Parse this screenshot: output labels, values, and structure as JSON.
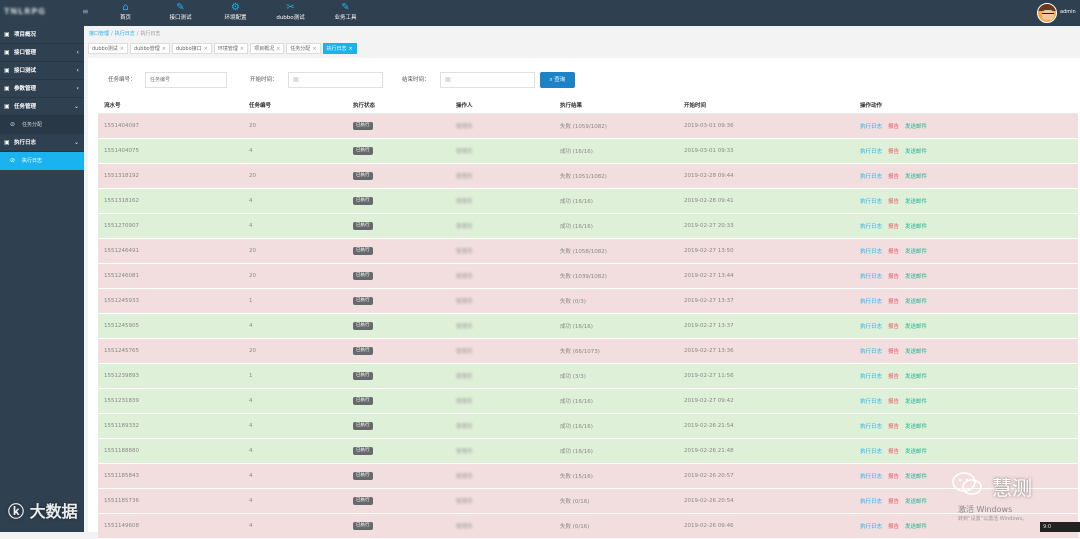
{
  "app": {
    "logo": "TNLRPG",
    "username": "admin"
  },
  "topnav": [
    {
      "label": "首页",
      "icon": "home-icon",
      "glyph": "⌂"
    },
    {
      "label": "接口测试",
      "icon": "edit-icon",
      "glyph": "✎"
    },
    {
      "label": "环境配置",
      "icon": "gear-icon",
      "glyph": "⚙"
    },
    {
      "label": "dubbo测试",
      "icon": "tools-icon",
      "glyph": "✂"
    },
    {
      "label": "业务工具",
      "icon": "wrench-icon",
      "glyph": "✎"
    }
  ],
  "sidebar": {
    "items": [
      {
        "label": "项目概况",
        "icon": "grid-icon",
        "arrow": ""
      },
      {
        "label": "接口管理",
        "icon": "grid-icon",
        "arrow": "‹"
      },
      {
        "label": "接口测试",
        "icon": "grid-icon",
        "arrow": "‹"
      },
      {
        "label": "参数管理",
        "icon": "grid-icon",
        "arrow": "‹"
      },
      {
        "label": "任务管理",
        "icon": "grid-icon",
        "arrow": "⌄"
      },
      {
        "label": "任务分配",
        "icon": "circle-check-icon",
        "arrow": "",
        "sub": true
      },
      {
        "label": "执行日志",
        "icon": "grid-icon",
        "arrow": "⌄"
      },
      {
        "label": "执行日志",
        "icon": "circle-check-icon",
        "arrow": "",
        "sub": true,
        "active": true
      }
    ]
  },
  "breadcrumb": {
    "items": [
      "接口管理",
      "执行日志",
      "执行日志"
    ],
    "separator": "/"
  },
  "tabs": [
    {
      "label": "dubbo测试",
      "active": false
    },
    {
      "label": "dubbo管理",
      "active": false
    },
    {
      "label": "dubbo接口",
      "active": false
    },
    {
      "label": "环境管理",
      "active": false
    },
    {
      "label": "项目概况",
      "active": false
    },
    {
      "label": "任务分配",
      "active": false
    },
    {
      "label": "执行日志",
      "active": true
    }
  ],
  "tab_close": "×",
  "filter": {
    "task_no_label": "任务编号：",
    "task_no_placeholder": "任务编号",
    "start_label": "开始时间：",
    "end_label": "结束时间：",
    "search_label": "查询",
    "search_icon": "search-icon"
  },
  "table": {
    "headers": [
      "流水号",
      "任务编号",
      "执行状态",
      "操作人",
      "执行结果",
      "开始时间",
      "操作动作"
    ],
    "actions": {
      "log": "执行日志",
      "report": "报告",
      "mail": "发送邮件"
    },
    "rows": [
      {
        "serial": "1551404097",
        "task": "20",
        "status": "已执行",
        "operator": "管理员",
        "result": "失败 (1059/1082)",
        "start": "2019-03-01 09:36",
        "state": "fail"
      },
      {
        "serial": "1551404075",
        "task": "4",
        "status": "已执行",
        "operator": "管理员",
        "result": "成功 (16/16)",
        "start": "2019-03-01 09:33",
        "state": "ok"
      },
      {
        "serial": "1551318192",
        "task": "20",
        "status": "已执行",
        "operator": "管理员",
        "result": "失败 (1051/1082)",
        "start": "2019-02-28 09:44",
        "state": "fail"
      },
      {
        "serial": "1551318162",
        "task": "4",
        "status": "已执行",
        "operator": "管理员",
        "result": "成功 (16/16)",
        "start": "2019-02-28 09:41",
        "state": "ok"
      },
      {
        "serial": "1551270907",
        "task": "4",
        "status": "已执行",
        "operator": "管理员",
        "result": "成功 (16/16)",
        "start": "2019-02-27 20:33",
        "state": "ok"
      },
      {
        "serial": "1551246491",
        "task": "20",
        "status": "已执行",
        "operator": "管理员",
        "result": "失败 (1058/1082)",
        "start": "2019-02-27 13:50",
        "state": "fail"
      },
      {
        "serial": "1551246081",
        "task": "20",
        "status": "已执行",
        "operator": "管理员",
        "result": "失败 (1039/1082)",
        "start": "2019-02-27 13:44",
        "state": "fail"
      },
      {
        "serial": "1551245933",
        "task": "1",
        "status": "已执行",
        "operator": "管理员",
        "result": "失败 (0/3)",
        "start": "2019-02-27 13:37",
        "state": "fail"
      },
      {
        "serial": "1551245905",
        "task": "4",
        "status": "已执行",
        "operator": "管理员",
        "result": "成功 (16/16)",
        "start": "2019-02-27 13:37",
        "state": "ok"
      },
      {
        "serial": "1551245765",
        "task": "20",
        "status": "已执行",
        "operator": "管理员",
        "result": "失败 (66/1073)",
        "start": "2019-02-27 13:36",
        "state": "fail"
      },
      {
        "serial": "1551239893",
        "task": "1",
        "status": "已执行",
        "operator": "管理员",
        "result": "成功 (3/3)",
        "start": "2019-02-27 11:56",
        "state": "ok"
      },
      {
        "serial": "1551231839",
        "task": "4",
        "status": "已执行",
        "operator": "管理员",
        "result": "成功 (16/16)",
        "start": "2019-02-27 09:42",
        "state": "ok"
      },
      {
        "serial": "1551189332",
        "task": "4",
        "status": "已执行",
        "operator": "管理员",
        "result": "成功 (16/16)",
        "start": "2019-02-26 21:54",
        "state": "ok"
      },
      {
        "serial": "1551188880",
        "task": "4",
        "status": "已执行",
        "operator": "管理员",
        "result": "成功 (16/16)",
        "start": "2019-02-26 21:48",
        "state": "ok"
      },
      {
        "serial": "1551185843",
        "task": "4",
        "status": "已执行",
        "operator": "管理员",
        "result": "失败 (15/16)",
        "start": "2019-02-26 20:57",
        "state": "fail"
      },
      {
        "serial": "1551185736",
        "task": "4",
        "status": "已执行",
        "operator": "管理员",
        "result": "失败 (0/16)",
        "start": "2019-02-26 20:54",
        "state": "fail"
      },
      {
        "serial": "1551149608",
        "task": "4",
        "status": "已执行",
        "operator": "管理员",
        "result": "失败 (0/16)",
        "start": "2019-02-26 09:46",
        "state": "fail"
      }
    ]
  },
  "colors": {
    "sidebar_bg": "#2f4050",
    "accent": "#1ab3f0",
    "fail_row": "#f2dede",
    "ok_row": "#dff0d8",
    "report": "#ed5565",
    "mail": "#1ab394"
  },
  "watermark": {
    "left": "大数据",
    "right": "慧测",
    "activate": "激活 Windows",
    "activate_sub": "转到“设置”以激活 Windows。"
  },
  "taskbar": "9:0"
}
